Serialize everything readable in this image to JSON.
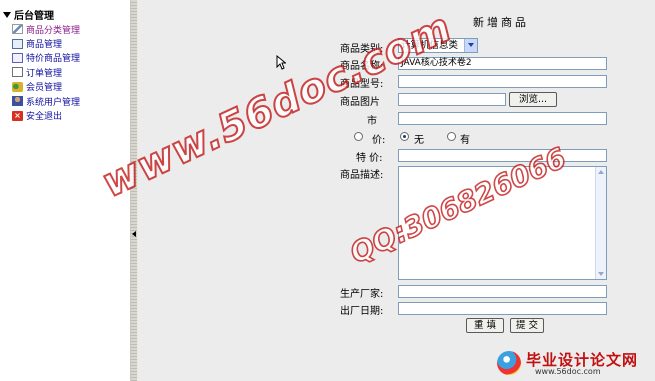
{
  "nav": {
    "title": "后台管理",
    "items": [
      {
        "label": "商品分类管理",
        "icon": "edit-icon"
      },
      {
        "label": "商品管理",
        "icon": "product-list-icon"
      },
      {
        "label": "特价商品管理",
        "icon": "special-product-icon"
      },
      {
        "label": "订单管理",
        "icon": "order-document-icon"
      },
      {
        "label": "会员管理",
        "icon": "member-icon"
      },
      {
        "label": "系统用户管理",
        "icon": "system-user-icon"
      },
      {
        "label": "安全退出",
        "icon": "exit-icon"
      }
    ]
  },
  "form": {
    "title": "新增商品",
    "category_label": "商品类别:",
    "category_value": "计算机信息类",
    "name_label": "商品名称:",
    "name_value": "JAVA核心技术卷2",
    "model_label": "商品型号:",
    "model_value": "",
    "image_label": "商品图片",
    "image_value": "",
    "browse_label": "浏览...",
    "market_price_label": "市",
    "market_price_value": "",
    "special_label": "价:",
    "special_options": [
      {
        "label": "无",
        "checked": true
      },
      {
        "label": "有",
        "checked": false
      }
    ],
    "special_price_label": "特  价:",
    "special_price_value": "",
    "description_label": "商品描述:",
    "description_value": "",
    "manufacturer_label": "生产厂家:",
    "manufacturer_value": "",
    "date_label": "出厂日期:",
    "date_value": "",
    "reset_label": "重 填",
    "submit_label": "提 交"
  },
  "watermark": {
    "site": "www.56doc.com",
    "qq": "QQ:306826066"
  },
  "footer_logo": {
    "title": "毕业设计论文网",
    "url": "www.56doc.com"
  },
  "colors": {
    "nav_link": "#1010a0",
    "nav_link_visited": "#8a1a8a",
    "form_bg": "#ececec",
    "watermark_red": "#c41a1a"
  }
}
